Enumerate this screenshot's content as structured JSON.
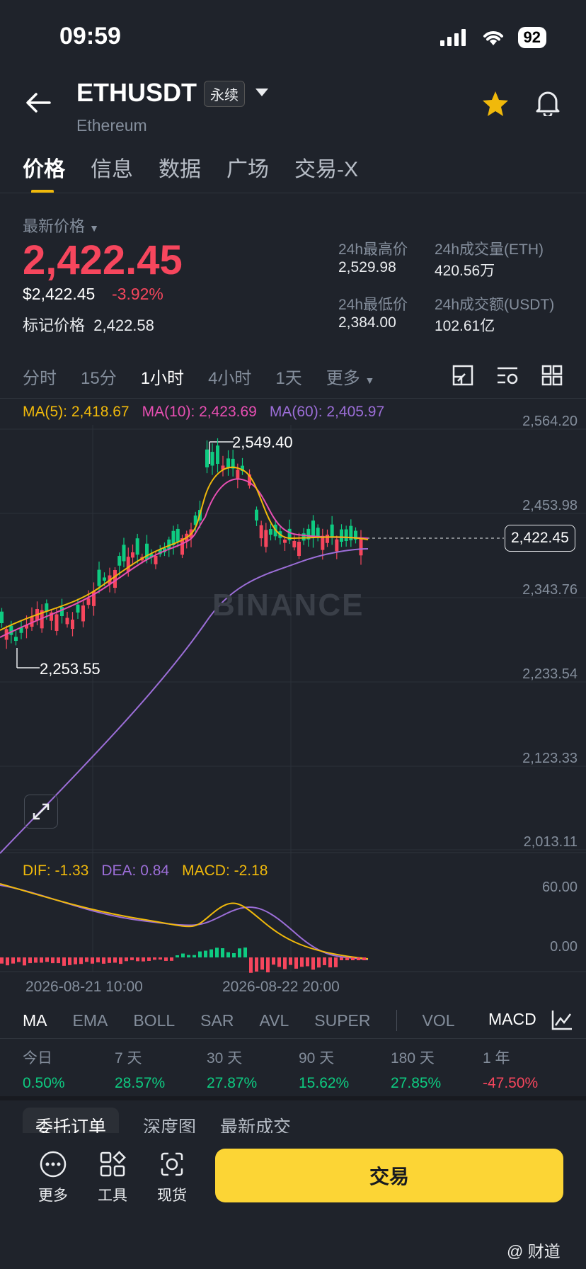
{
  "status": {
    "time": "09:59",
    "battery": "92"
  },
  "header": {
    "pair": "ETHUSDT",
    "badge": "永续",
    "name": "Ethereum"
  },
  "tabs": [
    "价格",
    "信息",
    "数据",
    "广场",
    "交易-X"
  ],
  "price": {
    "label": "最新价格",
    "last": "2,422.45",
    "usd": "$2,422.45",
    "change": "-3.92%",
    "mark_label": "标记价格",
    "mark": "2,422.58"
  },
  "stats": {
    "high_label": "24h最高价",
    "high": "2,529.98",
    "vol_label": "24h成交量(ETH)",
    "vol": "420.56万",
    "low_label": "24h最低价",
    "low": "2,384.00",
    "amt_label": "24h成交额(USDT)",
    "amt": "102.61亿"
  },
  "intervals": [
    "分时",
    "15分",
    "1小时",
    "4小时",
    "1天",
    "更多"
  ],
  "ma": {
    "ma5": "MA(5): 2,418.67",
    "ma10": "MA(10): 2,423.69",
    "ma60": "MA(60): 2,405.97"
  },
  "axis": [
    "2,564.20",
    "2,453.98",
    "2,343.76",
    "2,233.54",
    "2,123.33",
    "2,013.11"
  ],
  "annotations": {
    "high": "2,549.40",
    "low": "2,253.55",
    "current": "2,422.45"
  },
  "watermark": "BINANCE",
  "macd": {
    "dif": "DIF: -1.33",
    "dea": "DEA: 0.84",
    "macd": "MACD: -2.18",
    "axis_top": "60.00",
    "axis_zero": "0.00"
  },
  "dates": [
    "2026-08-21 10:00",
    "2026-08-22 20:00"
  ],
  "indicators": [
    "MA",
    "EMA",
    "BOLL",
    "SAR",
    "AVL",
    "SUPER",
    "VOL",
    "MACD"
  ],
  "performance": [
    {
      "label": "今日",
      "value": "0.50%"
    },
    {
      "label": "7 天",
      "value": "28.57%"
    },
    {
      "label": "30 天",
      "value": "27.87%"
    },
    {
      "label": "90 天",
      "value": "15.62%"
    },
    {
      "label": "180 天",
      "value": "27.85%"
    },
    {
      "label": "1 年",
      "value": "-47.50%"
    }
  ],
  "order_tabs": [
    "委托订单",
    "深度图",
    "最新成交"
  ],
  "bottom": {
    "more": "更多",
    "tools": "工具",
    "spot": "现货",
    "trade": "交易"
  },
  "footer_watermark": "@ 财道",
  "colors": {
    "up": "#0ecb81",
    "down": "#f6465d",
    "accent": "#fcd535",
    "ma5": "#f0b90b",
    "ma10": "#e84fb3",
    "ma60": "#9c6ed8"
  }
}
